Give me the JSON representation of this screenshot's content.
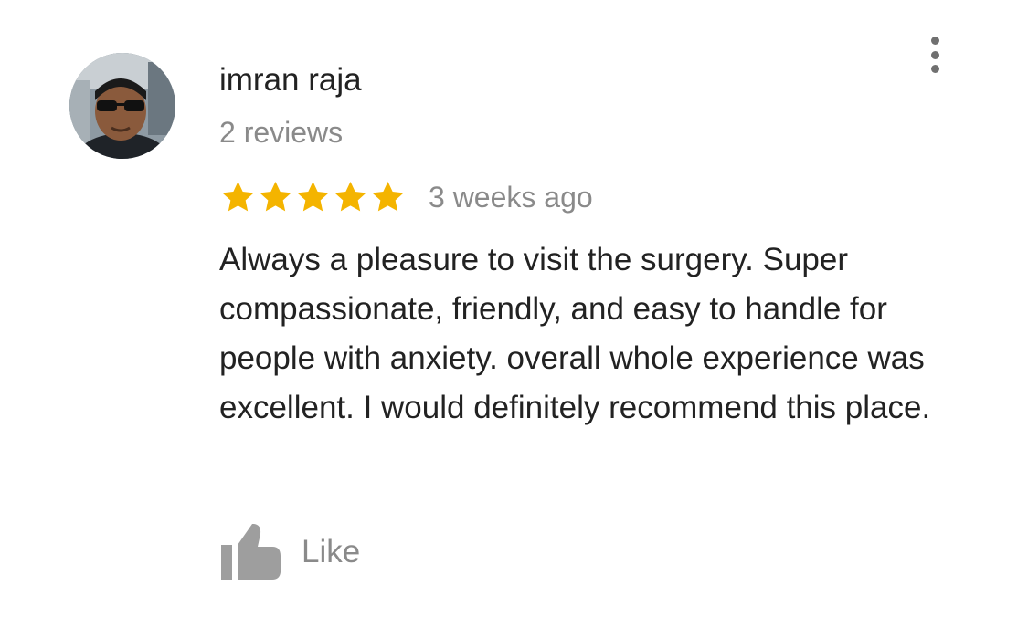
{
  "review": {
    "author_name": "imran raja",
    "review_count": "2 reviews",
    "rating": 5,
    "rating_max": 5,
    "time_ago": "3 weeks ago",
    "text": "Always a pleasure to visit the surgery. Super compassionate, friendly, and easy to handle for people with anxiety. overall whole experience was excellent. I would definitely recommend this place."
  },
  "actions": {
    "like_label": "Like",
    "like_icon": "thumbs-up-icon",
    "more_icon": "more-vertical-icon"
  },
  "colors": {
    "star": "#f4b400",
    "primary_text": "#222222",
    "secondary_text": "#8a8a8a",
    "icon_gray": "#9e9e9e"
  }
}
